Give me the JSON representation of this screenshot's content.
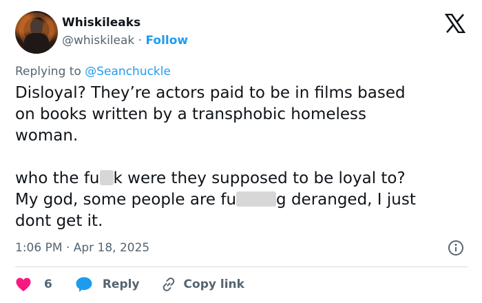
{
  "author": {
    "display_name": "Whiskileaks",
    "handle": "@whiskileak",
    "separator": "·",
    "follow_label": "Follow"
  },
  "replying_to": {
    "prefix": "Replying to",
    "mention": "@Seanchuckle"
  },
  "tweet": {
    "line1": "Disloyal?  They’re actors paid to be in films based",
    "line2": "on books written by a transphobic homeless",
    "line3": "woman.",
    "line4_a": "who the fu",
    "line4_b": "k were they supposed to be loyal to?",
    "line5_a": "My god, some people are fu",
    "line5_b": "g deranged, I just",
    "line6": "dont get it."
  },
  "timestamp": "1:06 PM · Apr 18, 2025",
  "actions": {
    "likes_count": "6",
    "reply_label": "Reply",
    "copy_link_label": "Copy link"
  },
  "icons": {
    "logo": "x-logo-icon",
    "info": "info-icon",
    "like": "heart-icon",
    "reply": "reply-bubble-icon",
    "copy": "link-icon"
  },
  "colors": {
    "link_blue": "#1d9bf0",
    "muted": "#536471",
    "heart_red": "#f91880",
    "text": "#0f1419"
  }
}
